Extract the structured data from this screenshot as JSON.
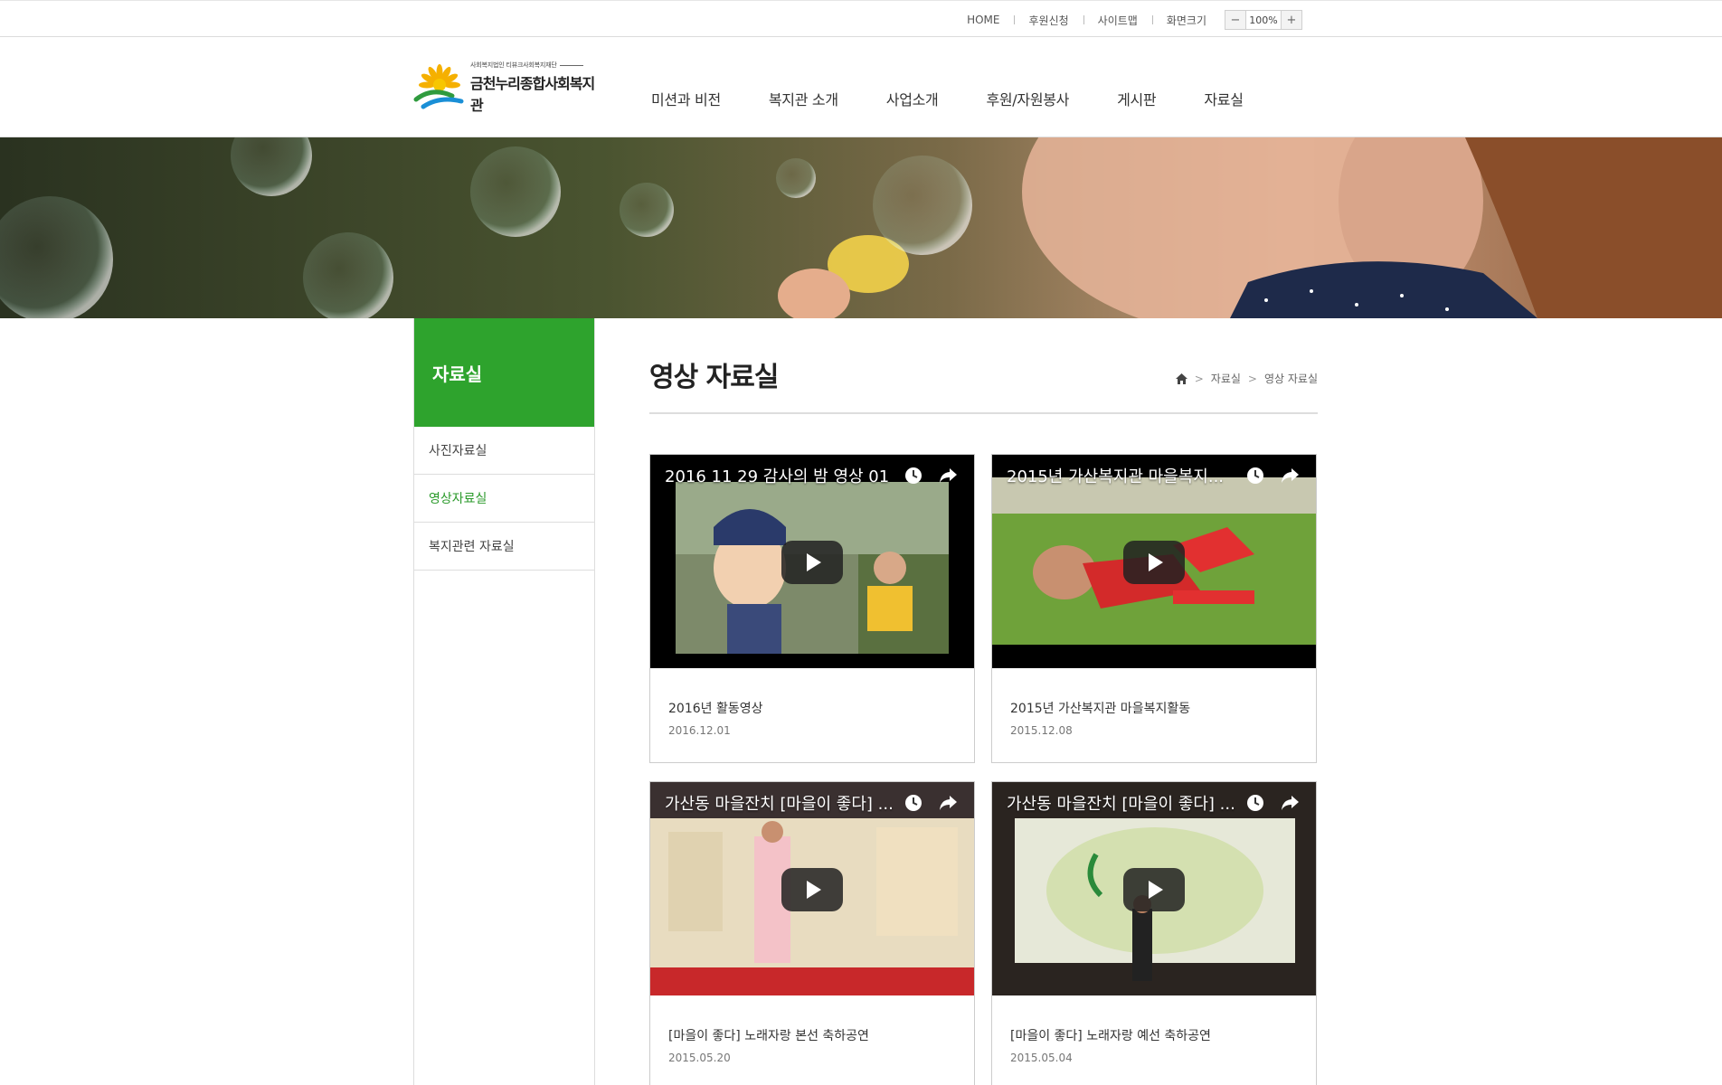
{
  "topbar": {
    "links": [
      "HOME",
      "후원신청",
      "사이트맵",
      "화면크기"
    ],
    "zoom_minus": "−",
    "zoom_value": "100%",
    "zoom_plus": "+"
  },
  "logo": {
    "subtitle": "사회복지법인 티뷰크사회복지재단",
    "name": "금천누리종합사회복지관"
  },
  "gnb": [
    "미션과 비전",
    "복지관 소개",
    "사업소개",
    "후원/자원봉사",
    "게시판",
    "자료실"
  ],
  "lnb": {
    "title": "자료실",
    "items": [
      "사진자료실",
      "영상자료실",
      "복지관련 자료실"
    ],
    "active_index": 1
  },
  "content": {
    "page_title": "영상 자료실",
    "breadcrumb": [
      "자료실",
      "영상 자료실"
    ]
  },
  "videos": [
    {
      "video_title": "2016 11 29 감사의 밤 영상 01",
      "title": "2016년 활동영상",
      "date": "2016.12.01"
    },
    {
      "video_title": "2015년 가산복지관 마을복지...",
      "title": "2015년 가산복지관 마을복지활동",
      "date": "2015.12.08"
    },
    {
      "video_title": "가산동 마을잔치 [마을이 좋다] ...",
      "title": "[마을이 좋다] 노래자랑 본선 축하공연",
      "date": "2015.05.20"
    },
    {
      "video_title": "가산동 마을잔치 [마을이 좋다] ...",
      "title": "[마을이 좋다] 노래자랑 예선 축하공연",
      "date": "2015.05.04"
    }
  ],
  "colors": {
    "accent": "#2ea32d",
    "active_text": "#2b9a2b"
  }
}
